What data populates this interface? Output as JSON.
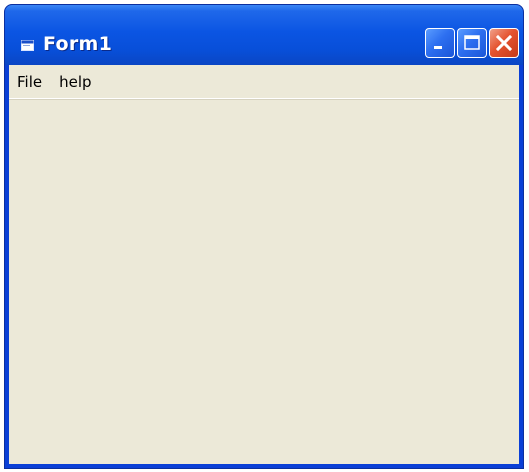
{
  "window": {
    "title": "Form1",
    "icon": "form-window-icon",
    "controls": [
      {
        "name": "minimize-icon"
      },
      {
        "name": "maximize-icon"
      },
      {
        "name": "close-icon"
      }
    ]
  },
  "menubar": {
    "items": [
      {
        "label": "File"
      },
      {
        "label": "help"
      }
    ]
  },
  "colors": {
    "titlebar": "#0b55e3",
    "client_background": "#ece9d8",
    "close_button": "#e5532f"
  }
}
